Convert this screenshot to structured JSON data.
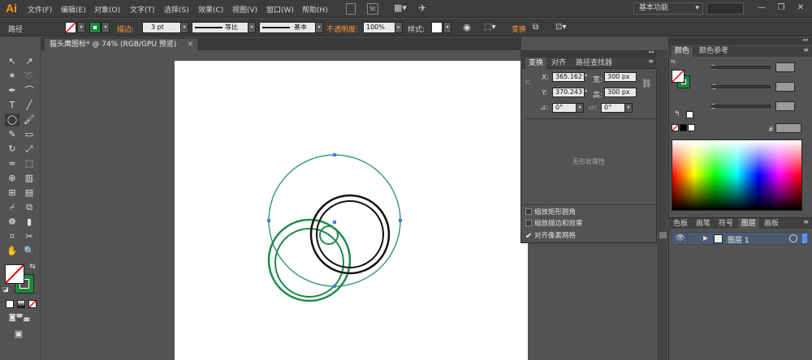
{
  "app": {
    "logo": "Ai"
  },
  "menu": [
    "文件(F)",
    "编辑(E)",
    "对象(O)",
    "文字(T)",
    "选择(S)",
    "效果(C)",
    "视图(V)",
    "窗口(W)",
    "帮助(H)"
  ],
  "menubar_icons": {
    "st_label": "St"
  },
  "workspace": {
    "label": "基本功能",
    "arrow": "▾"
  },
  "window_buttons": {
    "minimize": "—",
    "restore": "❐",
    "close": "✕"
  },
  "control_bar": {
    "object_type": "路径",
    "stroke_label": "描边:",
    "stroke_value": "3 pt",
    "line_style_1": "等比",
    "line_style_2": "基本",
    "opacity_label": "不透明度:",
    "opacity_value": "100%",
    "style_label": "样式:",
    "transform_label": "变换"
  },
  "document": {
    "tab_title": "猫头鹰图标* @ 74% (RGB/GPU 预览)",
    "close": "✕"
  },
  "transform_panel": {
    "tabs": [
      "变换",
      "对齐",
      "路径查找器"
    ],
    "x_label": "X:",
    "x_value": "365.162",
    "y_label": "Y:",
    "y_value": "370.243",
    "w_label": "宽:",
    "w_value": "300 px",
    "h_label": "高:",
    "h_value": "300 px",
    "rotate_value": "0°",
    "shear_value": "0°",
    "no_shape_text": "无形状属性",
    "options": [
      {
        "label": "缩放矩形圆角",
        "checked": false
      },
      {
        "label": "缩放描边和效果",
        "checked": false
      },
      {
        "label": "对齐像素网格",
        "checked": true
      }
    ]
  },
  "color_panel": {
    "tabs": [
      "颜色",
      "颜色参考"
    ],
    "channels": [
      "R",
      "G",
      "B"
    ],
    "hex_label": "#"
  },
  "layers_panel": {
    "tabs": [
      "色板",
      "画笔",
      "符号",
      "图层",
      "画板"
    ],
    "layer_name": "图层 1"
  },
  "colors": {
    "teal_circle": "#3d9a86",
    "green_circle": "#1f8a4c",
    "black_circle": "#111111",
    "selection_point": "#4a7bd4",
    "fill_swatch_green": "#1a8a3a"
  }
}
